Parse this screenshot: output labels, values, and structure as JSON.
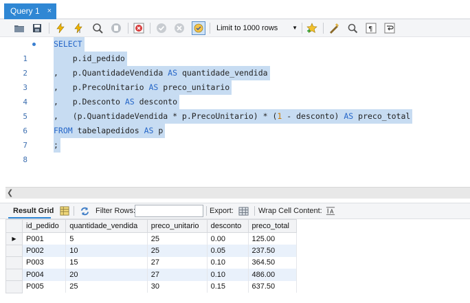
{
  "tab": {
    "title": "Query 1",
    "close": "×"
  },
  "toolbar": {
    "limit_label": "Limit to 1000 rows",
    "icons": [
      "open-folder-icon",
      "save-icon",
      "execute-icon",
      "execute-current-icon",
      "explain-icon",
      "stop-icon",
      "toggle-error-icon",
      "commit-icon",
      "rollback-icon",
      "autocommit-icon",
      "limit-dropdown",
      "add-snippet-icon",
      "beautify-icon",
      "find-icon",
      "invisible-chars-icon",
      "wrap-icon"
    ]
  },
  "editor": {
    "lines": [
      {
        "n": "1",
        "marker": true
      },
      {
        "n": "2"
      },
      {
        "n": "3"
      },
      {
        "n": "4"
      },
      {
        "n": "5"
      },
      {
        "n": "6"
      },
      {
        "n": "7"
      },
      {
        "n": "8"
      }
    ],
    "tokens": {
      "l1": [
        "SELECT"
      ],
      "l2": [
        "    p.id_pedido"
      ],
      "l3": [
        ",   p.QuantidadeVendida ",
        "AS",
        " quantidade_vendida"
      ],
      "l4": [
        ",   p.PrecoUnitario ",
        "AS",
        " preco_unitario"
      ],
      "l5": [
        ",   p.Desconto ",
        "AS",
        " desconto"
      ],
      "l6": [
        ",   (p.QuantidadeVendida * p.PrecoUnitario) * (",
        "1",
        " - desconto) ",
        "AS",
        " preco_total"
      ],
      "l7": [
        "FROM",
        " tabelapedidos ",
        "AS",
        " p"
      ],
      "l8": [
        ";"
      ]
    }
  },
  "result_toolbar": {
    "result_grid": "Result Grid",
    "filter_rows": "Filter Rows:",
    "filter_value": "",
    "export": "Export:",
    "wrap_cell": "Wrap Cell Content:"
  },
  "grid": {
    "columns": [
      "id_pedido",
      "quantidade_vendida",
      "preco_unitario",
      "desconto",
      "preco_total"
    ],
    "rows": [
      [
        "P001",
        "5",
        "25",
        "0.00",
        "125.00"
      ],
      [
        "P002",
        "10",
        "25",
        "0.05",
        "237.50"
      ],
      [
        "P003",
        "15",
        "27",
        "0.10",
        "364.50"
      ],
      [
        "P004",
        "20",
        "27",
        "0.10",
        "486.00"
      ],
      [
        "P005",
        "25",
        "30",
        "0.15",
        "637.50"
      ]
    ],
    "current_row_marker": "▶"
  },
  "colors": {
    "accent": "#2f87d4",
    "selection": "#c7dcf2",
    "keyword": "#2566c8",
    "number": "#cc7a00",
    "alt_row": "#e9f1fb"
  }
}
